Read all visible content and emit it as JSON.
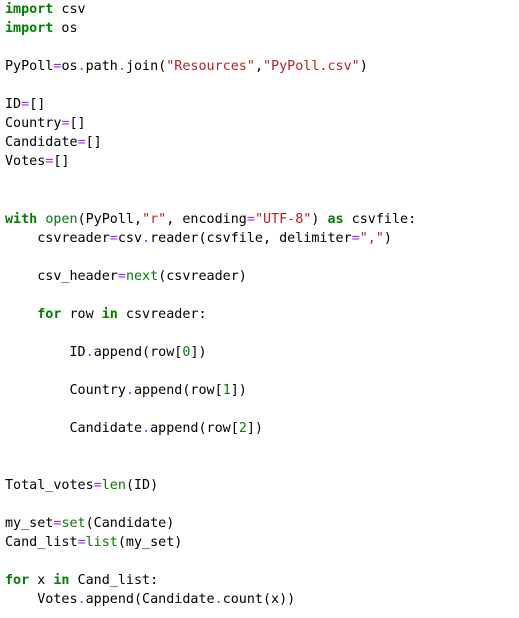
{
  "editor": {
    "language": "python",
    "colors": {
      "background": "#ffffff",
      "text": "#000000",
      "keyword": "#008000",
      "builtin": "#008000",
      "operator": "#aa22ff",
      "string": "#ba2121",
      "number": "#008000"
    },
    "lines": [
      [
        {
          "t": "kw",
          "v": "import"
        },
        {
          "t": "pl",
          "v": " csv"
        }
      ],
      [
        {
          "t": "kw",
          "v": "import"
        },
        {
          "t": "pl",
          "v": " os"
        }
      ],
      [],
      [
        {
          "t": "pl",
          "v": "PyPoll"
        },
        {
          "t": "op",
          "v": "="
        },
        {
          "t": "pl",
          "v": "os"
        },
        {
          "t": "op",
          "v": "."
        },
        {
          "t": "pl",
          "v": "path"
        },
        {
          "t": "op",
          "v": "."
        },
        {
          "t": "pl",
          "v": "join("
        },
        {
          "t": "str",
          "v": "\"Resources\""
        },
        {
          "t": "pl",
          "v": ","
        },
        {
          "t": "str",
          "v": "\"PyPoll.csv\""
        },
        {
          "t": "pl",
          "v": ")"
        }
      ],
      [],
      [
        {
          "t": "pl",
          "v": "ID"
        },
        {
          "t": "op",
          "v": "="
        },
        {
          "t": "pl",
          "v": "[]"
        }
      ],
      [
        {
          "t": "pl",
          "v": "Country"
        },
        {
          "t": "op",
          "v": "="
        },
        {
          "t": "pl",
          "v": "[]"
        }
      ],
      [
        {
          "t": "pl",
          "v": "Candidate"
        },
        {
          "t": "op",
          "v": "="
        },
        {
          "t": "pl",
          "v": "[]"
        }
      ],
      [
        {
          "t": "pl",
          "v": "Votes"
        },
        {
          "t": "op",
          "v": "="
        },
        {
          "t": "pl",
          "v": "[]"
        }
      ],
      [],
      [],
      [
        {
          "t": "kw",
          "v": "with"
        },
        {
          "t": "pl",
          "v": " "
        },
        {
          "t": "fn",
          "v": "open"
        },
        {
          "t": "pl",
          "v": "(PyPoll,"
        },
        {
          "t": "str",
          "v": "\"r\""
        },
        {
          "t": "pl",
          "v": ", encoding"
        },
        {
          "t": "op",
          "v": "="
        },
        {
          "t": "str",
          "v": "\"UTF-8\""
        },
        {
          "t": "pl",
          "v": ") "
        },
        {
          "t": "kw",
          "v": "as"
        },
        {
          "t": "pl",
          "v": " csvfile:"
        }
      ],
      [
        {
          "t": "pl",
          "v": "    csvreader"
        },
        {
          "t": "op",
          "v": "="
        },
        {
          "t": "pl",
          "v": "csv"
        },
        {
          "t": "op",
          "v": "."
        },
        {
          "t": "pl",
          "v": "reader(csvfile, delimiter"
        },
        {
          "t": "op",
          "v": "="
        },
        {
          "t": "str",
          "v": "\",\""
        },
        {
          "t": "pl",
          "v": ")"
        }
      ],
      [],
      [
        {
          "t": "pl",
          "v": "    csv_header"
        },
        {
          "t": "op",
          "v": "="
        },
        {
          "t": "fn",
          "v": "next"
        },
        {
          "t": "pl",
          "v": "(csvreader)"
        }
      ],
      [],
      [
        {
          "t": "pl",
          "v": "    "
        },
        {
          "t": "kw",
          "v": "for"
        },
        {
          "t": "pl",
          "v": " row "
        },
        {
          "t": "kw",
          "v": "in"
        },
        {
          "t": "pl",
          "v": " csvreader:"
        }
      ],
      [],
      [
        {
          "t": "pl",
          "v": "        ID"
        },
        {
          "t": "op",
          "v": "."
        },
        {
          "t": "pl",
          "v": "append(row["
        },
        {
          "t": "num",
          "v": "0"
        },
        {
          "t": "pl",
          "v": "])"
        }
      ],
      [],
      [
        {
          "t": "pl",
          "v": "        Country"
        },
        {
          "t": "op",
          "v": "."
        },
        {
          "t": "pl",
          "v": "append(row["
        },
        {
          "t": "num",
          "v": "1"
        },
        {
          "t": "pl",
          "v": "])"
        }
      ],
      [],
      [
        {
          "t": "pl",
          "v": "        Candidate"
        },
        {
          "t": "op",
          "v": "."
        },
        {
          "t": "pl",
          "v": "append(row["
        },
        {
          "t": "num",
          "v": "2"
        },
        {
          "t": "pl",
          "v": "])"
        }
      ],
      [],
      [],
      [
        {
          "t": "pl",
          "v": "Total_votes"
        },
        {
          "t": "op",
          "v": "="
        },
        {
          "t": "fn",
          "v": "len"
        },
        {
          "t": "pl",
          "v": "(ID)"
        }
      ],
      [],
      [
        {
          "t": "pl",
          "v": "my_set"
        },
        {
          "t": "op",
          "v": "="
        },
        {
          "t": "fn",
          "v": "set"
        },
        {
          "t": "pl",
          "v": "(Candidate)"
        }
      ],
      [
        {
          "t": "pl",
          "v": "Cand_list"
        },
        {
          "t": "op",
          "v": "="
        },
        {
          "t": "fn",
          "v": "list"
        },
        {
          "t": "pl",
          "v": "(my_set)"
        }
      ],
      [],
      [
        {
          "t": "kw",
          "v": "for"
        },
        {
          "t": "pl",
          "v": " x "
        },
        {
          "t": "kw",
          "v": "in"
        },
        {
          "t": "pl",
          "v": " Cand_list:"
        }
      ],
      [
        {
          "t": "pl",
          "v": "    Votes"
        },
        {
          "t": "op",
          "v": "."
        },
        {
          "t": "pl",
          "v": "append(Candidate"
        },
        {
          "t": "op",
          "v": "."
        },
        {
          "t": "pl",
          "v": "count(x))"
        }
      ]
    ]
  }
}
